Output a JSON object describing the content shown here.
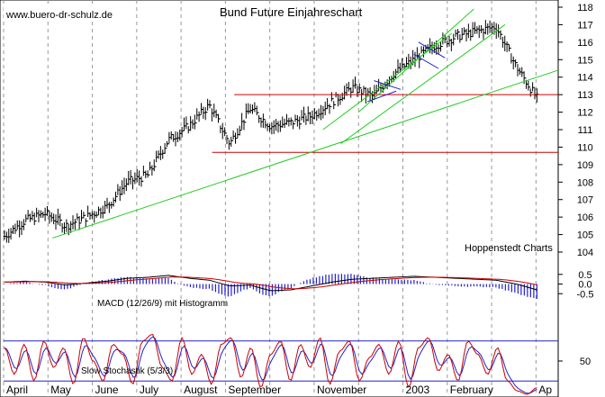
{
  "header": {
    "site": "www.buero-dr-schulz.de",
    "title": "Bund Future Einjahreschart"
  },
  "colors": {
    "price": "#000000",
    "trend": "#22cc22",
    "level": "#cc0000",
    "macd_hist": "#2222cc",
    "stoch_fast": "#cc0000",
    "stoch_slow": "#2222cc",
    "grid": "#999999"
  },
  "chart_data": [
    {
      "type": "bar",
      "name": "price",
      "title": "Bund Future Einjahreschart",
      "ylim": [
        104,
        118
      ],
      "y_ticks": [
        104,
        105,
        106,
        107,
        108,
        109,
        110,
        111,
        112,
        113,
        114,
        115,
        116,
        117,
        118
      ],
      "x_ticks": [
        "April",
        "May",
        "June",
        "July",
        "August",
        "September",
        "October",
        "November",
        "December",
        "2003",
        "February",
        "March",
        "Ap"
      ],
      "x_tick_labels_shown": [
        "April",
        "May",
        "June",
        "July",
        "August",
        "September",
        "",
        "November",
        "",
        "2003",
        "February",
        "",
        "Ap"
      ],
      "months_per_axis": 12.5,
      "close_by_month": [
        104.9,
        105.8,
        106.2,
        105.5,
        106.0,
        106.6,
        108.0,
        108.4,
        110.4,
        111.2,
        112.4,
        110.2,
        112.2,
        111.2,
        111.4,
        111.8,
        112.6,
        113.4,
        112.9,
        114.2,
        115.0,
        115.8,
        116.3,
        116.6,
        116.9,
        114.6,
        112.8
      ],
      "resistance_levels": [
        113.0,
        109.7
      ],
      "annotation": "Hoppenstedt Charts"
    },
    {
      "type": "bar",
      "name": "macd",
      "label": "MACD (12/26/9) mit Histogramm",
      "ylim": [
        -0.5,
        0.5
      ],
      "y_ticks": [
        0.5,
        0.0,
        -0.5
      ],
      "macd_by_month": [
        0.1,
        0.15,
        0.1,
        -0.05,
        0.05,
        0.15,
        0.3,
        0.35,
        0.45,
        0.3,
        0.2,
        -0.1,
        -0.05,
        -0.35,
        -0.3,
        -0.1,
        0.1,
        0.25,
        0.3,
        0.35,
        0.4,
        0.35,
        0.3,
        0.25,
        0.2,
        0.0,
        -0.3
      ]
    },
    {
      "type": "line",
      "name": "stochastic",
      "label": "Slow Stochastik (5/3/3)",
      "ylim": [
        0,
        100
      ],
      "y_ticks": [
        50
      ],
      "levels": [
        80,
        20
      ],
      "fast_by_point": [
        70,
        30,
        75,
        20,
        80,
        40,
        70,
        15,
        85,
        50,
        20,
        75,
        60,
        15,
        80,
        90,
        40,
        20,
        85,
        30,
        60,
        15,
        75,
        85,
        25,
        70,
        10,
        60,
        80,
        20,
        75,
        40,
        85,
        15,
        65,
        80,
        20,
        55,
        75,
        30,
        80,
        10,
        70,
        85,
        35,
        60,
        20,
        80,
        60,
        30,
        70,
        20,
        5,
        0,
        10
      ]
    }
  ]
}
